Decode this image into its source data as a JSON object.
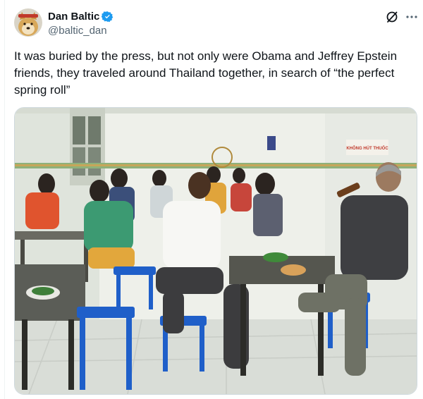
{
  "author": {
    "display_name": "Dan Baltic",
    "handle": "@baltic_dan",
    "verified": true,
    "avatar_icon": "doge-avatar",
    "verified_icon": "verified-badge-icon",
    "verified_color": "#1d9bf0"
  },
  "header_actions": {
    "grok_icon": "grok-icon",
    "more_icon": "more-options-icon"
  },
  "tweet": {
    "text": "It was buried by the press, but not only were Obama and Jeffrey Epstein friends, they traveled around Thailand together, in search of “the perfect spring roll”"
  },
  "photo": {
    "sign_text": "KHÔNG HÚT THUỐC"
  },
  "colors": {
    "text_primary": "#0f1419",
    "text_secondary": "#536471",
    "border": "#cfd9de",
    "stool_blue": "#1f5fc9"
  }
}
